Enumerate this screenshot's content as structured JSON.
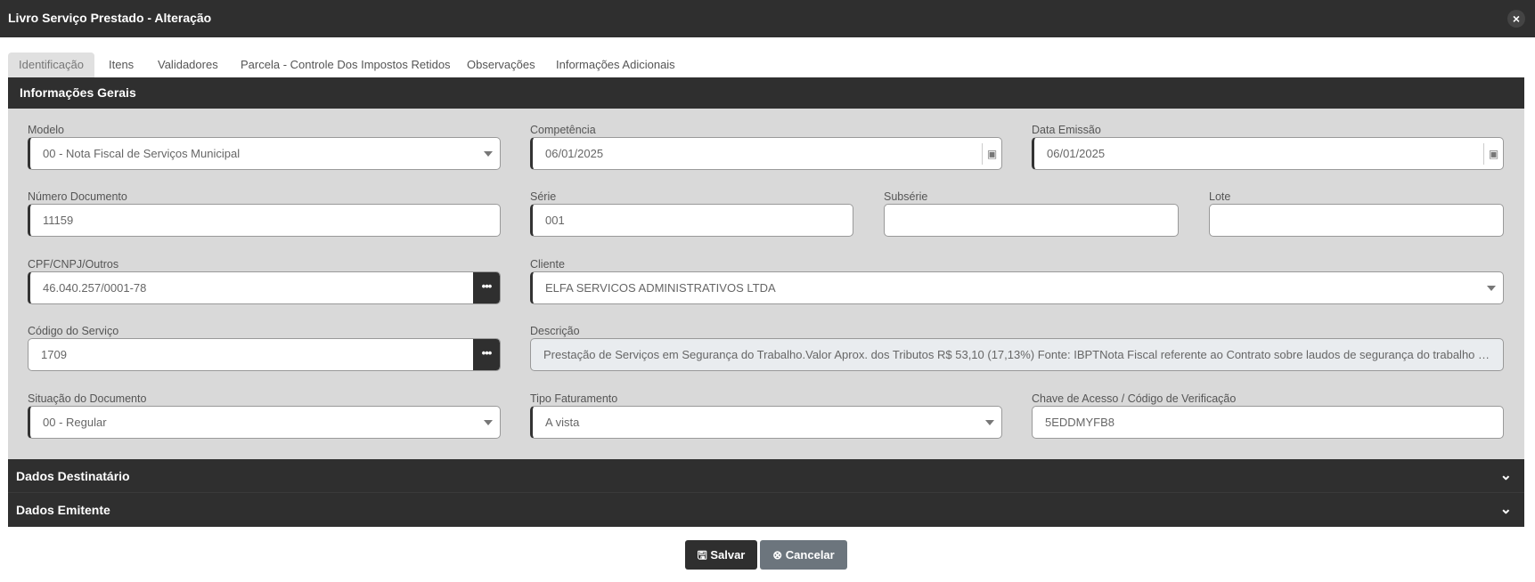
{
  "window": {
    "title": "Livro Serviço Prestado - Alteração",
    "close_icon": "×"
  },
  "tabs": [
    "Identificação",
    "Itens",
    "Validadores",
    "Parcela - Controle Dos Impostos Retidos",
    "Observações",
    "Informações Adicionais"
  ],
  "section": "Informações Gerais",
  "fields": {
    "modelo": {
      "label": "Modelo",
      "value": "00 - Nota Fiscal de Serviços Municipal"
    },
    "competencia": {
      "label": "Competência",
      "value": "06/01/2025"
    },
    "data_emissao": {
      "label": "Data Emissão",
      "value": "06/01/2025"
    },
    "numero": {
      "label": "Número Documento",
      "value": "11159"
    },
    "serie": {
      "label": "Série",
      "value": "001"
    },
    "subserie": {
      "label": "Subsérie",
      "value": ""
    },
    "lote": {
      "label": "Lote",
      "value": ""
    },
    "cpf": {
      "label": "CPF/CNPJ/Outros",
      "value": "46.040.257/0001-78"
    },
    "cliente": {
      "label": "Cliente",
      "value": "ELFA SERVICOS ADMINISTRATIVOS LTDA"
    },
    "codigo": {
      "label": "Código do Serviço",
      "value": "1709"
    },
    "descricao": {
      "label": "Descrição",
      "value": "Prestação de Serviços em Segurança do Trabalho.Valor Aprox. dos Tributos R$ 53,10 (17,13%) Fonte: IBPTNota Fiscal referente ao Contrato sobre laudos de segurança do trabalho e e-s..."
    },
    "situacao": {
      "label": "Situação do Documento",
      "value": "00 - Regular"
    },
    "tipo": {
      "label": "Tipo Faturamento",
      "value": "A vista"
    },
    "chave": {
      "label": "Chave de Acesso / Código de Verificação",
      "value": "5EDDMYFB8"
    }
  },
  "accordions": [
    "Dados Destinatário",
    "Dados Emitente"
  ],
  "buttons": {
    "save": "Salvar",
    "cancel": "Cancelar"
  }
}
